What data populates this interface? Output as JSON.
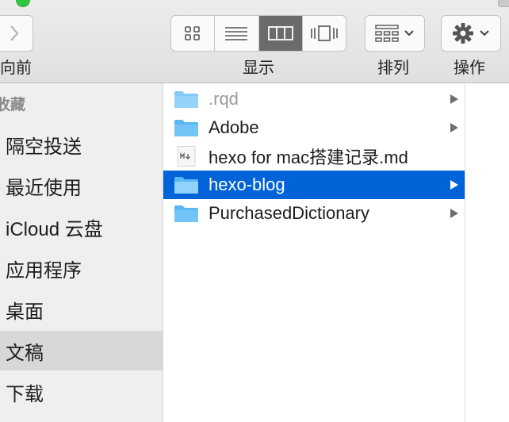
{
  "toolbar": {
    "forward_label": "向前",
    "view_label": "显示",
    "arrange_label": "排列",
    "action_label": "操作",
    "view_modes": [
      {
        "icon": "icon-view-icon",
        "active": false
      },
      {
        "icon": "list-view-icon",
        "active": false
      },
      {
        "icon": "column-view-icon",
        "active": true
      },
      {
        "icon": "cover-flow-view-icon",
        "active": false
      }
    ]
  },
  "sidebar": {
    "header": "收藏",
    "items": [
      {
        "label": "隔空投送"
      },
      {
        "label": "最近使用"
      },
      {
        "label": "iCloud 云盘"
      },
      {
        "label": "应用程序"
      },
      {
        "label": "桌面"
      },
      {
        "label": "文稿",
        "selected": true
      },
      {
        "label": "下载"
      }
    ]
  },
  "files": [
    {
      "name": ".rqd",
      "type": "folder",
      "dimmed": true,
      "has_children": true
    },
    {
      "name": "Adobe",
      "type": "folder",
      "has_children": true
    },
    {
      "name": "hexo for mac搭建记录.md",
      "type": "markdown",
      "has_children": false
    },
    {
      "name": "hexo-blog",
      "type": "folder",
      "selected": true,
      "has_children": true
    },
    {
      "name": "PurchasedDictionary",
      "type": "folder",
      "has_children": true
    }
  ],
  "colors": {
    "selection": "#0064d8",
    "folder": "#5ab7f2",
    "sidebar_bg": "#efefef"
  }
}
